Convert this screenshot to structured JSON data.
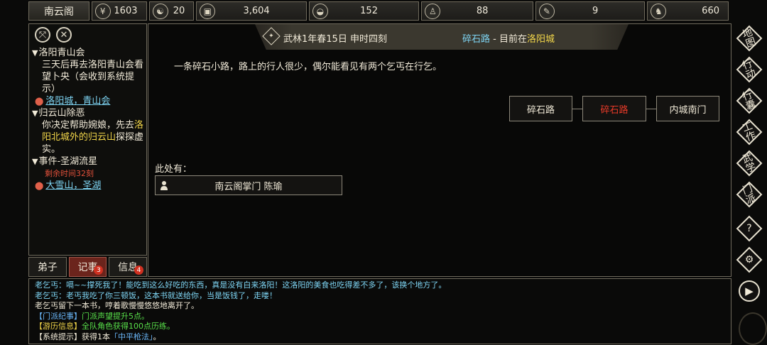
{
  "stats": {
    "sect_name": "南云阁",
    "items": [
      {
        "icon": "coin-icon",
        "glyph": "¥",
        "value": "1603"
      },
      {
        "icon": "yin-yang-icon",
        "glyph": "☯",
        "value": "20"
      },
      {
        "icon": "money-icon",
        "glyph": "▣",
        "value": "3,604"
      },
      {
        "icon": "food-bowl-icon",
        "glyph": "◒",
        "value": "152"
      },
      {
        "icon": "meditation-icon",
        "glyph": "♙",
        "value": "88"
      },
      {
        "icon": "scroll-icon",
        "glyph": "✎",
        "value": "9"
      },
      {
        "icon": "beast-icon",
        "glyph": "♞",
        "value": "660"
      }
    ]
  },
  "quests": [
    {
      "title": "洛阳青山会",
      "text": [
        "三天后再去洛阳青山会看望卜央（会收到系统提示）"
      ],
      "location": "洛阳城，青山会"
    },
    {
      "title": "归云山除恶",
      "text_a": "你决定帮助婉娘，先去",
      "text_hl": "洛阳北城外的归云山",
      "text_b": "探探虚实。"
    },
    {
      "title": "事件-圣湖流星",
      "time": "剩余时间32刻",
      "location": "大雪山，圣湖"
    }
  ],
  "left_tabs": [
    {
      "label": "弟子",
      "badge": ""
    },
    {
      "label": "记事",
      "badge": "3"
    },
    {
      "label": "信息",
      "badge": "4"
    }
  ],
  "header": {
    "date": "武林1年春15日 申时四刻",
    "place": "碎石路",
    "sep": " - 目前在",
    "city": "洛阳城"
  },
  "description": "一条碎石小路，路上的行人很少，偶尔能看见有两个乞丐在行乞。",
  "map_nodes": [
    "碎石路",
    "碎石路",
    "内城南门"
  ],
  "here_label": "此处有：",
  "npc": "南云阁掌门 陈瑜",
  "right_menu": [
    {
      "name": "map-button",
      "label": "地图"
    },
    {
      "name": "action-button",
      "label": "行动"
    },
    {
      "name": "bag-button",
      "label": "行囊"
    },
    {
      "name": "work-button",
      "label": "工作"
    },
    {
      "name": "martial-button",
      "label": "武学"
    },
    {
      "name": "sect-button",
      "label": "门派"
    },
    {
      "name": "help-button",
      "label": "?"
    },
    {
      "name": "settings-button",
      "label": "⚙"
    },
    {
      "name": "play-button",
      "label": "▶"
    }
  ],
  "log": [
    {
      "cls": "cyan",
      "text": "老乞丐：嗝~~撑死我了！能吃到这么好吃的东西，真是没有白来洛阳！这洛阳的美食也吃得差不多了，该换个地方了。"
    },
    {
      "cls": "cyan",
      "text": "老乞丐：老丐我吃了你三顿饭，这本书就送给你，当是饭钱了，走喽！"
    },
    {
      "cls": "",
      "text": "老乞丐留下一本书，哼着歌慢慢悠悠地离开了。"
    },
    {
      "tag": "【门派纪事】",
      "tagcls": "green",
      "cls": "green",
      "text": "门派声望提升5点。"
    },
    {
      "tag": "【游历信息】",
      "tagcls": "yellow",
      "cls": "green",
      "text": "全队角色获得100点历练。"
    },
    {
      "tag": "【系统提示】",
      "tagcls": "",
      "cls": "",
      "text": "获得1本",
      "extra": "「中平枪法」",
      "extracls": "blue",
      "tail": "。"
    }
  ]
}
